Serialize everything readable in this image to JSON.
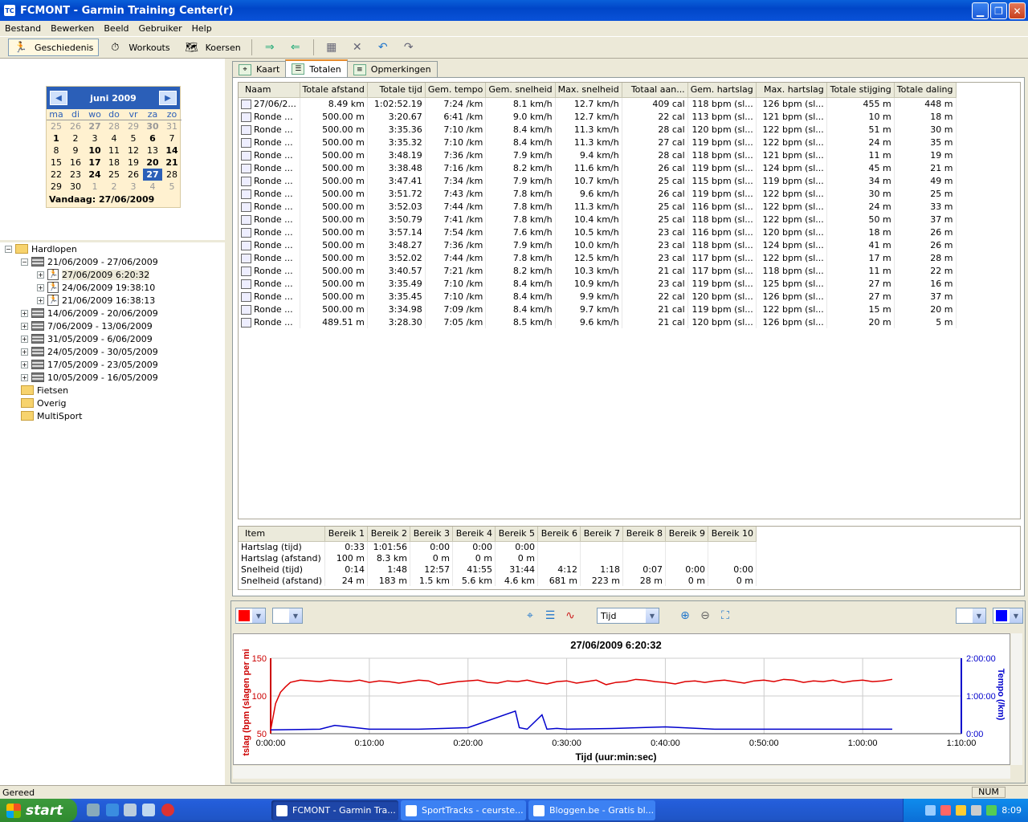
{
  "window": {
    "title": "FCMONT - Garmin Training Center(r)",
    "app_icon": "TC"
  },
  "menu": [
    "Bestand",
    "Bewerken",
    "Beeld",
    "Gebruiker",
    "Help"
  ],
  "toolbar": {
    "history": "Geschiedenis",
    "workouts": "Workouts",
    "courses": "Koersen"
  },
  "calendar": {
    "month": "juni 2009",
    "days": [
      "ma",
      "di",
      "wo",
      "do",
      "vr",
      "za",
      "zo"
    ],
    "weeks": [
      [
        "25",
        "26",
        "27",
        "28",
        "29",
        "30",
        "31"
      ],
      [
        "1",
        "2",
        "3",
        "4",
        "5",
        "6",
        "7"
      ],
      [
        "8",
        "9",
        "10",
        "11",
        "12",
        "13",
        "14"
      ],
      [
        "15",
        "16",
        "17",
        "18",
        "19",
        "20",
        "21"
      ],
      [
        "22",
        "23",
        "24",
        "25",
        "26",
        "27",
        "28"
      ],
      [
        "29",
        "30",
        "1",
        "2",
        "3",
        "4",
        "5"
      ]
    ],
    "today": "Vandaag: 27/06/2009"
  },
  "tree": {
    "root": "Hardlopen",
    "week_current": "21/06/2009 - 27/06/2009",
    "activities": [
      "27/06/2009 6:20:32",
      "24/06/2009 19:38:10",
      "21/06/2009 16:38:13"
    ],
    "weeks": [
      "14/06/2009 - 20/06/2009",
      "7/06/2009 - 13/06/2009",
      "31/05/2009 - 6/06/2009",
      "24/05/2009 - 30/05/2009",
      "17/05/2009 - 23/05/2009",
      "10/05/2009 - 16/05/2009"
    ],
    "folders": [
      "Fietsen",
      "Overig",
      "MultiSport"
    ]
  },
  "tabs": [
    "Kaart",
    "Totalen",
    "Opmerkingen"
  ],
  "laps_table": {
    "columns": [
      "Naam",
      "Totale afstand",
      "Totale tijd",
      "Gem. tempo",
      "Gem. snelheid",
      "Max. snelheid",
      "Totaal aan...",
      "Gem. hartslag",
      "Max. hartslag",
      "Totale stijging",
      "Totale daling"
    ],
    "rows": [
      [
        "27/06/2...",
        "8.49 km",
        "1:02:52.19",
        "7:24 /km",
        "8.1 km/h",
        "12.7 km/h",
        "409 cal",
        "118 bpm (sl...",
        "126 bpm (sl...",
        "455 m",
        "448 m"
      ],
      [
        "Ronde ...",
        "500.00 m",
        "3:20.67",
        "6:41 /km",
        "9.0 km/h",
        "12.7 km/h",
        "22 cal",
        "113 bpm (sl...",
        "121 bpm (sl...",
        "10 m",
        "18 m"
      ],
      [
        "Ronde ...",
        "500.00 m",
        "3:35.36",
        "7:10 /km",
        "8.4 km/h",
        "11.3 km/h",
        "28 cal",
        "120 bpm (sl...",
        "122 bpm (sl...",
        "51 m",
        "30 m"
      ],
      [
        "Ronde ...",
        "500.00 m",
        "3:35.32",
        "7:10 /km",
        "8.4 km/h",
        "11.3 km/h",
        "27 cal",
        "119 bpm (sl...",
        "122 bpm (sl...",
        "24 m",
        "35 m"
      ],
      [
        "Ronde ...",
        "500.00 m",
        "3:48.19",
        "7:36 /km",
        "7.9 km/h",
        "9.4 km/h",
        "28 cal",
        "118 bpm (sl...",
        "121 bpm (sl...",
        "11 m",
        "19 m"
      ],
      [
        "Ronde ...",
        "500.00 m",
        "3:38.48",
        "7:16 /km",
        "8.2 km/h",
        "11.6 km/h",
        "26 cal",
        "119 bpm (sl...",
        "124 bpm (sl...",
        "45 m",
        "21 m"
      ],
      [
        "Ronde ...",
        "500.00 m",
        "3:47.41",
        "7:34 /km",
        "7.9 km/h",
        "10.7 km/h",
        "25 cal",
        "115 bpm (sl...",
        "119 bpm (sl...",
        "34 m",
        "49 m"
      ],
      [
        "Ronde ...",
        "500.00 m",
        "3:51.72",
        "7:43 /km",
        "7.8 km/h",
        "9.6 km/h",
        "26 cal",
        "119 bpm (sl...",
        "122 bpm (sl...",
        "30 m",
        "25 m"
      ],
      [
        "Ronde ...",
        "500.00 m",
        "3:52.03",
        "7:44 /km",
        "7.8 km/h",
        "11.3 km/h",
        "25 cal",
        "116 bpm (sl...",
        "122 bpm (sl...",
        "24 m",
        "33 m"
      ],
      [
        "Ronde ...",
        "500.00 m",
        "3:50.79",
        "7:41 /km",
        "7.8 km/h",
        "10.4 km/h",
        "25 cal",
        "118 bpm (sl...",
        "122 bpm (sl...",
        "50 m",
        "37 m"
      ],
      [
        "Ronde ...",
        "500.00 m",
        "3:57.14",
        "7:54 /km",
        "7.6 km/h",
        "10.5 km/h",
        "23 cal",
        "116 bpm (sl...",
        "120 bpm (sl...",
        "18 m",
        "26 m"
      ],
      [
        "Ronde ...",
        "500.00 m",
        "3:48.27",
        "7:36 /km",
        "7.9 km/h",
        "10.0 km/h",
        "23 cal",
        "118 bpm (sl...",
        "124 bpm (sl...",
        "41 m",
        "26 m"
      ],
      [
        "Ronde ...",
        "500.00 m",
        "3:52.02",
        "7:44 /km",
        "7.8 km/h",
        "12.5 km/h",
        "23 cal",
        "117 bpm (sl...",
        "122 bpm (sl...",
        "17 m",
        "28 m"
      ],
      [
        "Ronde ...",
        "500.00 m",
        "3:40.57",
        "7:21 /km",
        "8.2 km/h",
        "10.3 km/h",
        "21 cal",
        "117 bpm (sl...",
        "118 bpm (sl...",
        "11 m",
        "22 m"
      ],
      [
        "Ronde ...",
        "500.00 m",
        "3:35.49",
        "7:10 /km",
        "8.4 km/h",
        "10.9 km/h",
        "23 cal",
        "119 bpm (sl...",
        "125 bpm (sl...",
        "27 m",
        "16 m"
      ],
      [
        "Ronde ...",
        "500.00 m",
        "3:35.45",
        "7:10 /km",
        "8.4 km/h",
        "9.9 km/h",
        "22 cal",
        "120 bpm (sl...",
        "126 bpm (sl...",
        "27 m",
        "37 m"
      ],
      [
        "Ronde ...",
        "500.00 m",
        "3:34.98",
        "7:09 /km",
        "8.4 km/h",
        "9.7 km/h",
        "21 cal",
        "119 bpm (sl...",
        "122 bpm (sl...",
        "15 m",
        "20 m"
      ],
      [
        "Ronde ...",
        "489.51 m",
        "3:28.30",
        "7:05 /km",
        "8.5 km/h",
        "9.6 km/h",
        "21 cal",
        "120 bpm (sl...",
        "126 bpm (sl...",
        "20 m",
        "5 m"
      ]
    ]
  },
  "zones_table": {
    "columns": [
      "Item",
      "Bereik 1",
      "Bereik 2",
      "Bereik 3",
      "Bereik 4",
      "Bereik 5",
      "Bereik 6",
      "Bereik 7",
      "Bereik 8",
      "Bereik 9",
      "Bereik 10"
    ],
    "rows": [
      [
        "Hartslag (tijd)",
        "0:33",
        "1:01:56",
        "0:00",
        "0:00",
        "0:00",
        "",
        "",
        "",
        "",
        ""
      ],
      [
        "Hartslag (afstand)",
        "100 m",
        "8.3 km",
        "0 m",
        "0 m",
        "0 m",
        "",
        "",
        "",
        "",
        ""
      ],
      [
        "Snelheid (tijd)",
        "0:14",
        "1:48",
        "12:57",
        "41:55",
        "31:44",
        "4:12",
        "1:18",
        "0:07",
        "0:00",
        "0:00"
      ],
      [
        "Snelheid (afstand)",
        "24 m",
        "183 m",
        "1.5 km",
        "5.6 km",
        "4.6 km",
        "681 m",
        "223 m",
        "28 m",
        "0 m",
        "0 m"
      ]
    ]
  },
  "chart_controls": {
    "x_axis_select": "Tijd",
    "left_color": "#ff0000",
    "right_color": "#0000ff"
  },
  "chart_data": {
    "type": "line",
    "title": "27/06/2009 6:20:32",
    "xlabel": "Tijd (uur:min:sec)",
    "ylabel_left": "tslag (bpm (slagen per mi",
    "ylabel_right": "Tempo (/km)",
    "x_ticks": [
      "0:00:00",
      "0:10:00",
      "0:20:00",
      "0:30:00",
      "0:40:00",
      "0:50:00",
      "1:00:00",
      "1:10:00"
    ],
    "y_left_ticks": [
      "50",
      "100",
      "150"
    ],
    "y_right_ticks": [
      "0:00",
      "1:00:00",
      "2:00:00"
    ],
    "y_left_range": [
      50,
      150
    ],
    "x_range_minutes": [
      0,
      70
    ],
    "series": [
      {
        "name": "heart_rate",
        "color": "#dd0000",
        "axis": "left",
        "x_min": [
          0,
          0.5,
          1,
          1.5,
          2,
          3,
          4,
          5,
          6,
          7,
          8,
          9,
          10,
          11,
          12,
          13,
          14,
          15,
          16,
          17,
          18,
          19,
          20,
          21,
          22,
          23,
          24,
          25,
          26,
          27,
          28,
          29,
          30,
          31,
          32,
          33,
          34,
          35,
          36,
          37,
          38,
          39,
          40,
          41,
          42,
          43,
          44,
          45,
          46,
          47,
          48,
          49,
          50,
          51,
          52,
          53,
          54,
          55,
          56,
          57,
          58,
          59,
          60,
          61,
          62,
          63
        ],
        "y": [
          55,
          90,
          105,
          112,
          118,
          121,
          120,
          119,
          121,
          120,
          119,
          121,
          118,
          120,
          119,
          117,
          119,
          121,
          120,
          115,
          117,
          119,
          120,
          121,
          118,
          117,
          120,
          119,
          121,
          118,
          116,
          119,
          120,
          117,
          119,
          121,
          115,
          118,
          119,
          122,
          121,
          119,
          118,
          116,
          119,
          120,
          118,
          120,
          121,
          119,
          117,
          120,
          121,
          119,
          122,
          121,
          118,
          120,
          119,
          121,
          118,
          120,
          121,
          119,
          120,
          122
        ],
        "x_label_note": ""
      },
      {
        "name": "pace",
        "color": "#0000cc",
        "axis": "right",
        "x_min": [
          0,
          5,
          6.5,
          10,
          15,
          20,
          24.8,
          25.2,
          26,
          27.5,
          28,
          29,
          30,
          35,
          40,
          45,
          50,
          55,
          60,
          63
        ],
        "y_frac": [
          0.05,
          0.06,
          0.11,
          0.06,
          0.06,
          0.08,
          0.3,
          0.08,
          0.06,
          0.25,
          0.06,
          0.07,
          0.06,
          0.07,
          0.09,
          0.06,
          0.06,
          0.06,
          0.06,
          0.06
        ]
      }
    ]
  },
  "status": {
    "left": "Gereed",
    "num": "NUM"
  },
  "taskbar": {
    "start": "start",
    "tasks": [
      "FCMONT - Garmin Tra...",
      "SportTracks - ceurste...",
      "Bloggen.be - Gratis bl..."
    ],
    "clock": "8:09"
  }
}
